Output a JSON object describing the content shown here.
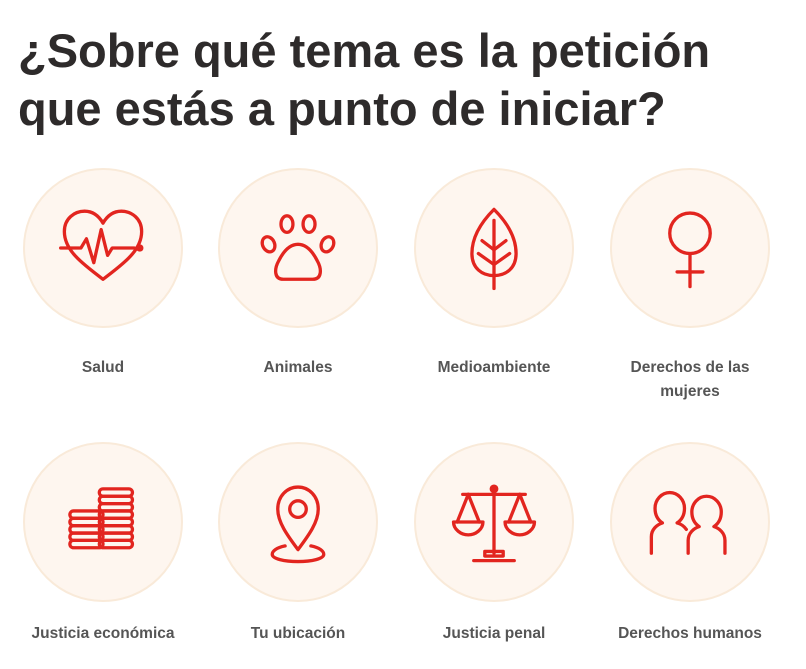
{
  "title": "¿Sobre qué tema es la petición que estás a punto de iniciar?",
  "accent_color": "#e2251f",
  "circle_color": "#fef6ef",
  "categories": [
    {
      "label": "Salud",
      "icon": "heart-pulse-icon"
    },
    {
      "label": "Animales",
      "icon": "paw-icon"
    },
    {
      "label": "Medioambiente",
      "icon": "leaf-icon"
    },
    {
      "label": "Derechos de las mujeres",
      "icon": "female-symbol-icon"
    },
    {
      "label": "Justicia económica",
      "icon": "coins-stack-icon"
    },
    {
      "label": "Tu ubicación",
      "icon": "location-pin-icon"
    },
    {
      "label": "Justicia penal",
      "icon": "scales-icon"
    },
    {
      "label": "Derechos humanos",
      "icon": "people-icon"
    }
  ]
}
